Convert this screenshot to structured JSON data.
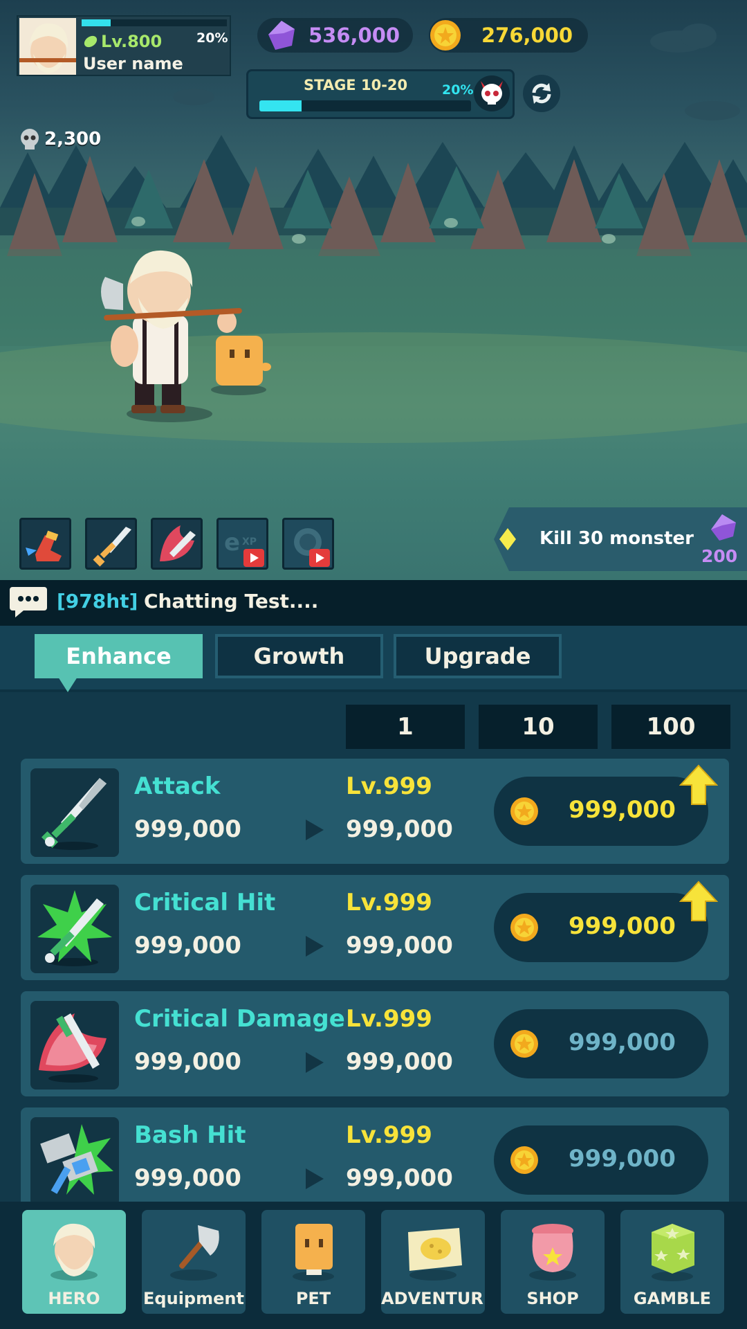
{
  "player": {
    "level": "Lv.800",
    "xp_percent": 20,
    "xp_label": "20%",
    "username": "User name"
  },
  "currency": {
    "gems": "536,000",
    "coins": "276,000"
  },
  "stage": {
    "label": "STAGE 10-20",
    "percent": 20,
    "percent_label": "20%"
  },
  "skull_count": "2,300",
  "quest": {
    "text": "Kill 30 monster",
    "reward": "200"
  },
  "chat": {
    "room": "[978ht]",
    "message": "Chatting Test...."
  },
  "tabs": [
    "Enhance",
    "Growth",
    "Upgrade"
  ],
  "multipliers": [
    "1",
    "10",
    "100"
  ],
  "upgrades": [
    {
      "name": "Attack",
      "current": "999,000",
      "level": "Lv.999",
      "next": "999,000",
      "cost": "999,000",
      "affordable": true
    },
    {
      "name": "Critical Hit",
      "current": "999,000",
      "level": "Lv.999",
      "next": "999,000",
      "cost": "999,000",
      "affordable": true
    },
    {
      "name": "Critical Damage",
      "current": "999,000",
      "level": "Lv.999",
      "next": "999,000",
      "cost": "999,000",
      "affordable": false
    },
    {
      "name": "Bash Hit",
      "current": "999,000",
      "level": "Lv.999",
      "next": "999,000",
      "cost": "999,000",
      "affordable": false
    }
  ],
  "nav": [
    "HERO",
    "Equipment",
    "PET",
    "ADVENTURE",
    "SHOP",
    "GAMBLE"
  ],
  "colors": {
    "accent": "#5ec4b6",
    "gold": "#f7e33a",
    "gem": "#c58cf4",
    "cyan": "#33e0ec"
  }
}
